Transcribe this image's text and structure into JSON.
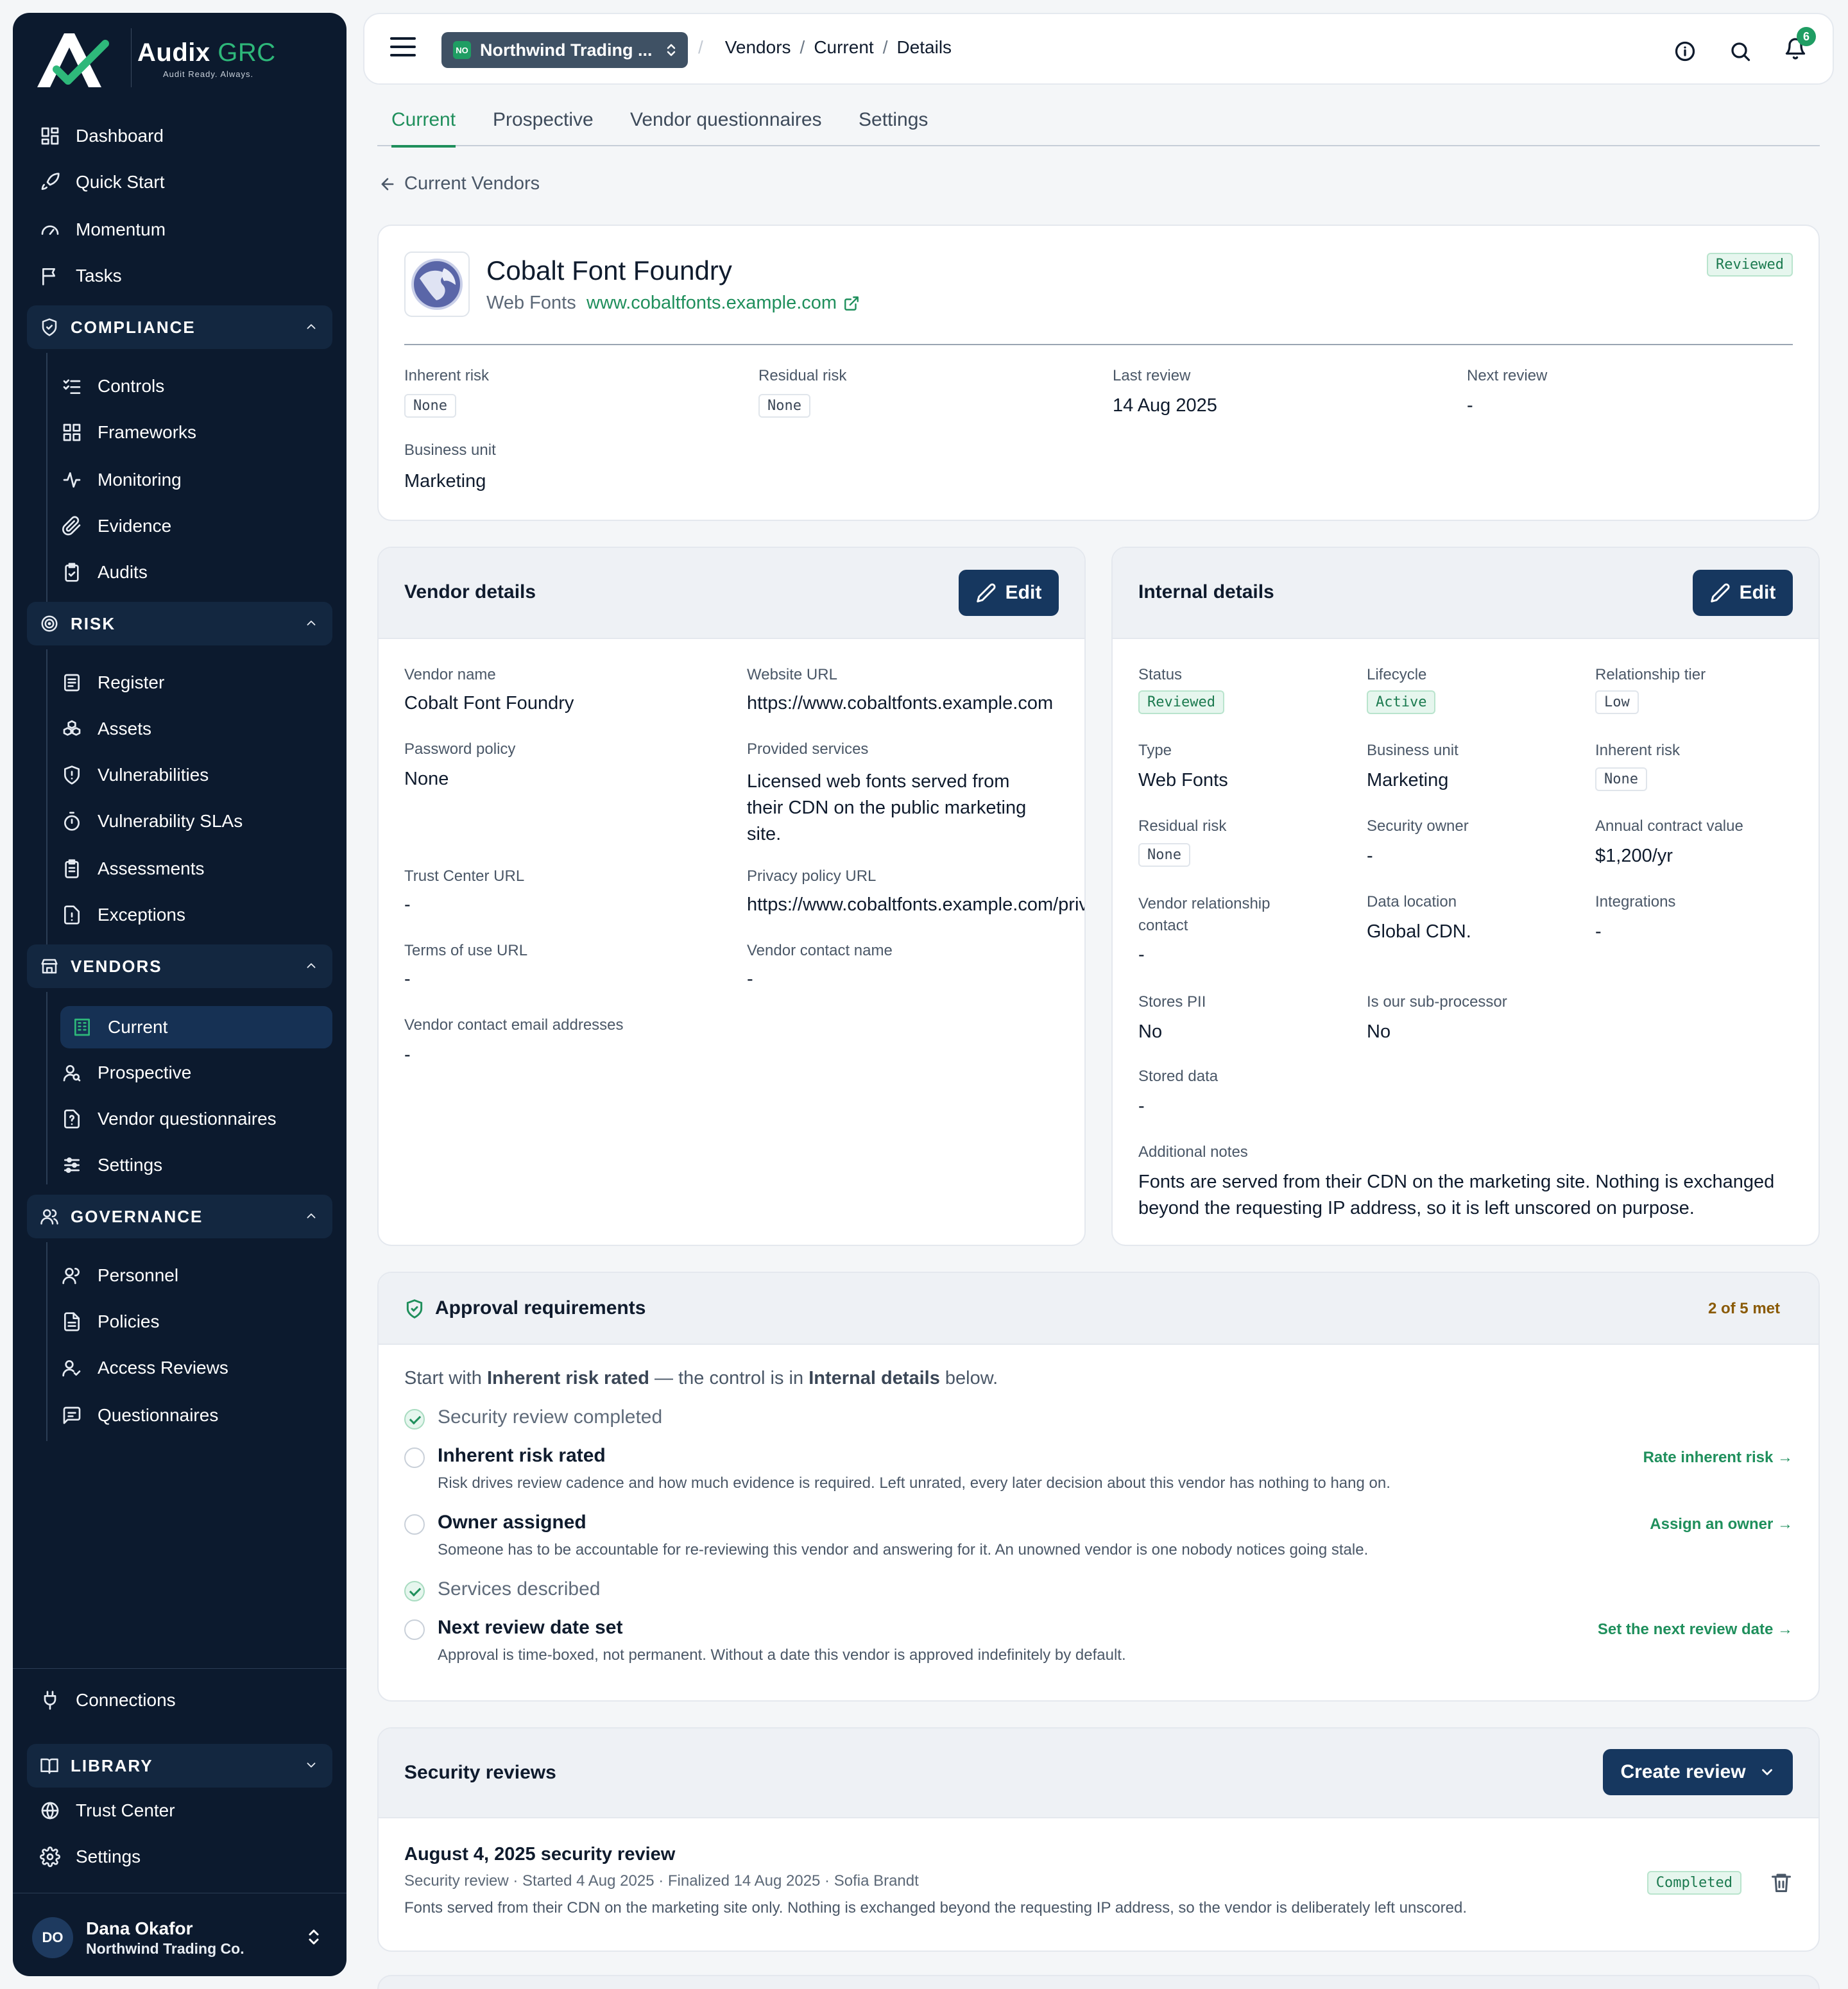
{
  "brand": {
    "name": "Audix",
    "suffix": "GRC",
    "tagline": "Audit Ready. Always."
  },
  "sidebar": {
    "top_items": [
      {
        "label": "Dashboard",
        "icon": "grid-icon"
      },
      {
        "label": "Quick Start",
        "icon": "rocket-icon"
      },
      {
        "label": "Momentum",
        "icon": "gauge-icon"
      },
      {
        "label": "Tasks",
        "icon": "flag-icon"
      }
    ],
    "sections": {
      "compliance": {
        "label": "COMPLIANCE",
        "items": [
          "Controls",
          "Frameworks",
          "Monitoring",
          "Evidence",
          "Audits"
        ]
      },
      "risk": {
        "label": "RISK",
        "items": [
          "Register",
          "Assets",
          "Vulnerabilities",
          "Vulnerability SLAs",
          "Assessments",
          "Exceptions"
        ]
      },
      "vendors": {
        "label": "VENDORS",
        "items": [
          "Current",
          "Prospective",
          "Vendor questionnaires",
          "Settings"
        ]
      },
      "governance": {
        "label": "GOVERNANCE",
        "items": [
          "Personnel",
          "Policies",
          "Access Reviews",
          "Questionnaires"
        ]
      },
      "library": {
        "label": "LIBRARY"
      }
    },
    "connections": "Connections",
    "bottom_items": [
      "Trust Center",
      "Settings"
    ],
    "user": {
      "initials": "DO",
      "name": "Dana Okafor",
      "org": "Northwind Trading Co."
    }
  },
  "topbar": {
    "org_badge": "NO",
    "org_name": "Northwind Trading ...",
    "breadcrumb": [
      "Vendors",
      "Current",
      "Details"
    ],
    "notifications": "6"
  },
  "tabs": [
    "Current",
    "Prospective",
    "Vendor questionnaires",
    "Settings"
  ],
  "back_link": "Current Vendors",
  "vendor": {
    "name": "Cobalt Font Foundry",
    "category": "Web Fonts",
    "website": "www.cobaltfonts.example.com",
    "status_tag": "Reviewed",
    "inherent_risk_label": "Inherent risk",
    "inherent_risk": "None",
    "residual_risk_label": "Residual risk",
    "residual_risk": "None",
    "last_review_label": "Last review",
    "last_review": "14 Aug 2025",
    "next_review_label": "Next review",
    "next_review": "-",
    "business_unit_label": "Business unit",
    "business_unit": "Marketing"
  },
  "vendor_details": {
    "title": "Vendor details",
    "edit": "Edit",
    "vendor_name_label": "Vendor name",
    "vendor_name": "Cobalt Font Foundry",
    "website_label": "Website URL",
    "website": "https://www.cobaltfonts.example.com",
    "password_policy_label": "Password policy",
    "password_policy": "None",
    "services_label": "Provided services",
    "services": "Licensed web fonts served from their CDN on the public marketing site.",
    "trust_center_label": "Trust Center URL",
    "trust_center": "-",
    "privacy_label": "Privacy policy URL",
    "privacy": "https://www.cobaltfonts.example.com/privacy",
    "terms_label": "Terms of use URL",
    "terms": "-",
    "contact_name_label": "Vendor contact name",
    "contact_name": "-",
    "contact_email_label": "Vendor contact email addresses",
    "contact_email": "-"
  },
  "internal_details": {
    "title": "Internal details",
    "edit": "Edit",
    "status_label": "Status",
    "status": "Reviewed",
    "lifecycle_label": "Lifecycle",
    "lifecycle": "Active",
    "tier_label": "Relationship tier",
    "tier": "Low",
    "type_label": "Type",
    "type": "Web Fonts",
    "bu_label": "Business unit",
    "bu": "Marketing",
    "inherent_label": "Inherent risk",
    "inherent": "None",
    "residual_label": "Residual risk",
    "residual": "None",
    "owner_label": "Security owner",
    "owner": "-",
    "contract_label": "Annual contract value",
    "contract": "$1,200/yr",
    "rel_contact_label": "Vendor relationship contact",
    "rel_contact": "-",
    "data_location_label": "Data location",
    "data_location": "Global CDN.",
    "integrations_label": "Integrations",
    "integrations": "-",
    "pii_label": "Stores PII",
    "pii": "No",
    "subproc_label": "Is our sub-processor",
    "subproc": "No",
    "stored_data_label": "Stored data",
    "stored_data": "-",
    "notes_label": "Additional notes",
    "notes": "Fonts are served from their CDN on the marketing site. Nothing is exchanged beyond the requesting IP address, so it is left unscored on purpose."
  },
  "approval": {
    "title": "Approval requirements",
    "progress": "2 of 5 met",
    "intro_a": "Start with ",
    "intro_b": "Inherent risk rated",
    "intro_c": " — the control is in ",
    "intro_d": "Internal details",
    "intro_e": " below.",
    "items": [
      {
        "title": "Security review completed",
        "done": true
      },
      {
        "title": "Inherent risk rated",
        "desc": "Risk drives review cadence and how much evidence is required. Left unrated, every later decision about this vendor has nothing to hang on.",
        "link": "Rate inherent risk"
      },
      {
        "title": "Owner assigned",
        "desc": "Someone has to be accountable for re-reviewing this vendor and answering for it. An unowned vendor is one nobody notices going stale.",
        "link": "Assign an owner"
      },
      {
        "title": "Services described",
        "done": true
      },
      {
        "title": "Next review date set",
        "desc": "Approval is time-boxed, not permanent. Without a date this vendor is approved indefinitely by default.",
        "link": "Set the next review date"
      }
    ]
  },
  "security_reviews": {
    "title": "Security reviews",
    "create": "Create review",
    "review": {
      "title": "August 4, 2025 security review",
      "meta": "Security review · Started 4 Aug 2025 · Finalized 14 Aug 2025 · Sofia Brandt",
      "desc": "Fonts served from their CDN on the marketing site only. Nothing is exchanged beyond the requesting IP address, so the vendor is deliberately left unscored.",
      "status": "Completed"
    }
  },
  "colors": {
    "brand_green": "#1f8f5c",
    "navy": "#0c1a2e",
    "button": "#16375f"
  }
}
